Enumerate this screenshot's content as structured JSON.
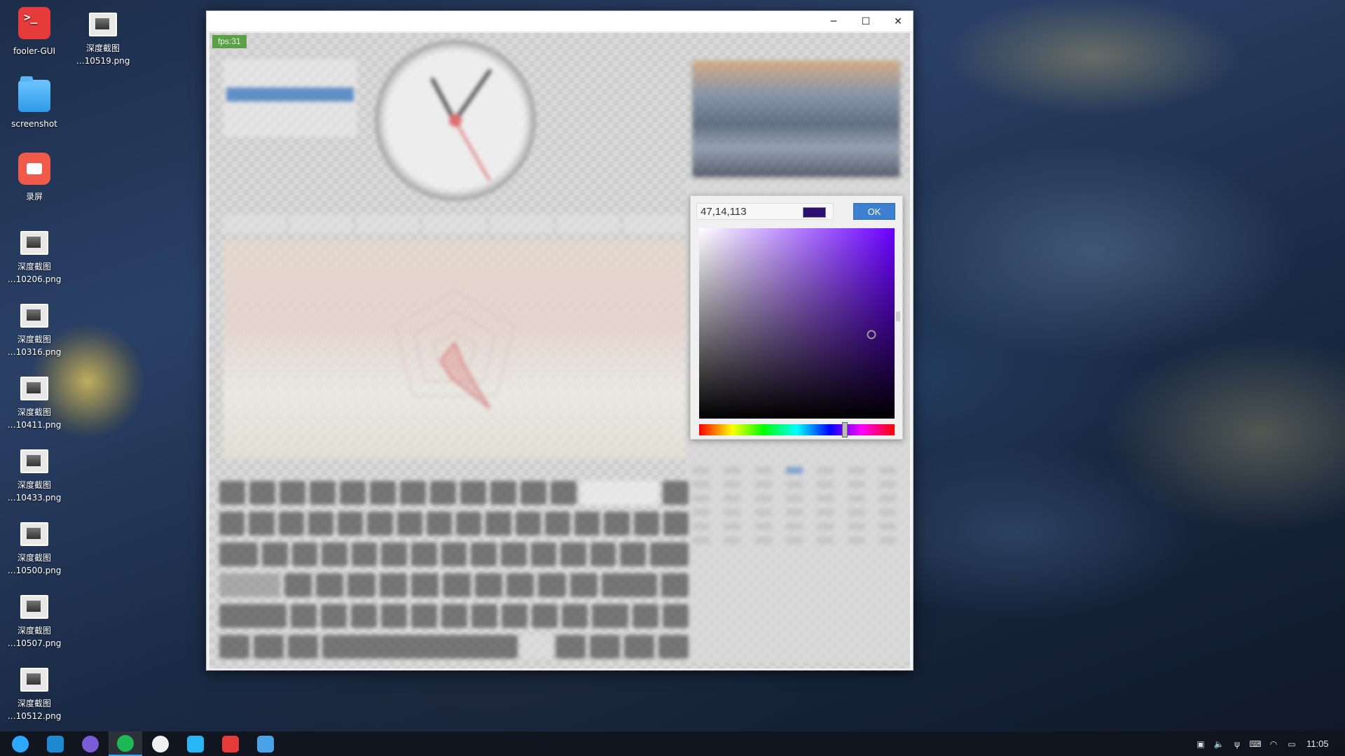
{
  "desktop": {
    "icons": [
      {
        "label": "fooler-GUI",
        "label2": "",
        "icon": "terminal-app-icon"
      },
      {
        "label": "深度截图",
        "label2": "…10519.png",
        "icon": "image-file-icon"
      },
      {
        "label": "screenshot",
        "label2": "",
        "icon": "folder-icon"
      },
      {
        "label": "录屏",
        "label2": "",
        "icon": "screen-recorder-icon"
      },
      {
        "label": "深度截图",
        "label2": "…10206.png",
        "icon": "image-file-icon"
      },
      {
        "label": "深度截图",
        "label2": "…10316.png",
        "icon": "image-file-icon"
      },
      {
        "label": "深度截图",
        "label2": "…10411.png",
        "icon": "image-file-icon"
      },
      {
        "label": "深度截图",
        "label2": "…10433.png",
        "icon": "image-file-icon"
      },
      {
        "label": "深度截图",
        "label2": "…10500.png",
        "icon": "image-file-icon"
      },
      {
        "label": "深度截图",
        "label2": "…10507.png",
        "icon": "image-file-icon"
      },
      {
        "label": "深度截图",
        "label2": "…10512.png",
        "icon": "image-file-icon"
      }
    ]
  },
  "window": {
    "controls": {
      "minimize": "─",
      "maximize": "☐",
      "close": "✕"
    },
    "fps_label": "fps:31",
    "color_picker": {
      "value": "47,14,113",
      "swatch_color": "#2f0e71",
      "ok_label": "OK",
      "hue_color": "#6a00ff",
      "hue_fraction": 0.745,
      "saturation_fraction": 0.88,
      "brightness_fraction": 0.44
    }
  },
  "taskbar": {
    "apps": [
      {
        "icon": "launcher-icon",
        "color": "#2ea8ff"
      },
      {
        "icon": "vscode-icon",
        "color": "#1f8ad2"
      },
      {
        "icon": "system-monitor-icon",
        "color": "#7b5cd6"
      },
      {
        "icon": "browser-icon",
        "color": "#1db954"
      },
      {
        "icon": "terminal-yin-yang-icon",
        "color": "#f0f0f0"
      },
      {
        "icon": "app-store-icon",
        "color": "#29b6f6"
      },
      {
        "icon": "terminal-icon",
        "color": "#e53b3b"
      },
      {
        "icon": "screenshot-viewer-icon",
        "color": "#4aa3e8"
      }
    ],
    "tray": [
      {
        "icon": "gpu-icon",
        "glyph": "▣"
      },
      {
        "icon": "volume-icon",
        "glyph": "🔈"
      },
      {
        "icon": "usb-icon",
        "glyph": "ψ"
      },
      {
        "icon": "keyboard-icon",
        "glyph": "⌨"
      },
      {
        "icon": "wifi-icon",
        "glyph": "◠"
      },
      {
        "icon": "battery-icon",
        "glyph": "▭"
      }
    ],
    "time": "11:05"
  }
}
